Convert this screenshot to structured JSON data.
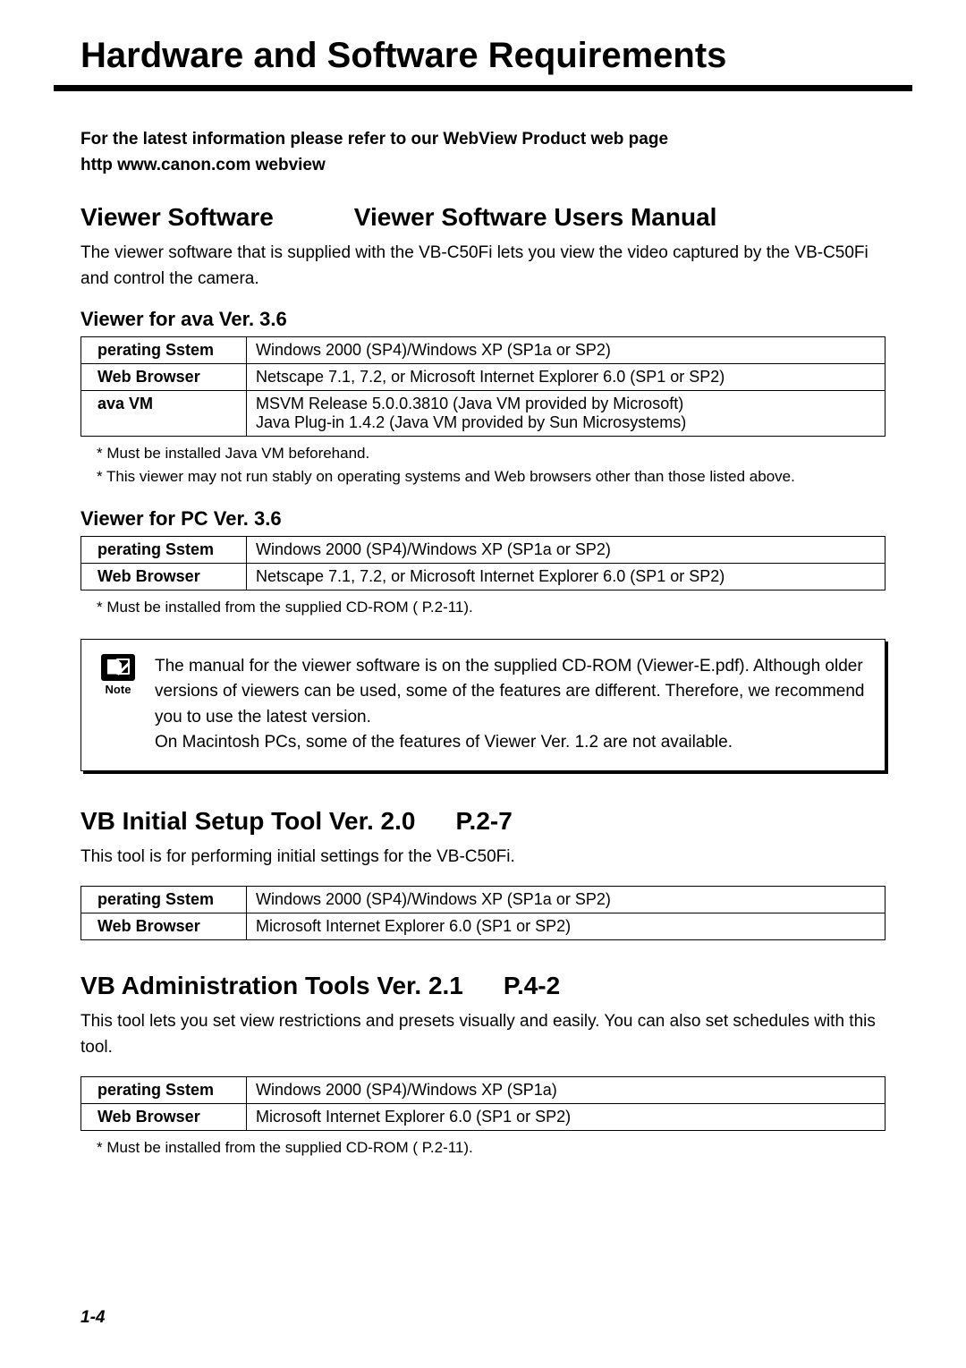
{
  "title": "Hardware and Software Requirements",
  "intro_line1": "For the latest information  please refer to our WebView Product web page",
  "intro_line2": "http   www.canon.com webview",
  "viewer": {
    "heading_left": "Viewer Software",
    "heading_right": "Viewer Software Users Manual",
    "desc": "The viewer software that is supplied with the VB-C50Fi lets you view the video captured by the VB-C50Fi and control the camera.",
    "java": {
      "title": "Viewer for  ava Ver. 3.6",
      "rows": [
        {
          "label": "perating Sstem",
          "value": "Windows 2000 (SP4)/Windows XP (SP1a or SP2)"
        },
        {
          "label": "Web Browser",
          "value": "Netscape 7.1, 7.2, or Microsoft Internet Explorer 6.0 (SP1 or SP2)"
        },
        {
          "label": "ava VM",
          "value": "MSVM Release 5.0.0.3810 (Java VM provided by Microsoft)\nJava Plug-in 1.4.2 (Java VM provided by Sun Microsystems)"
        }
      ],
      "footnote1": "* Must be installed Java VM beforehand.",
      "footnote2": "* This viewer may not run stably on operating systems and Web browsers other than those listed above."
    },
    "pc": {
      "title": "Viewer for PC Ver. 3.6",
      "rows": [
        {
          "label": "perating Sstem",
          "value": "Windows 2000 (SP4)/Windows XP (SP1a or SP2)"
        },
        {
          "label": "Web Browser",
          "value": "Netscape 7.1, 7.2, or Microsoft Internet Explorer 6.0 (SP1 or SP2)"
        }
      ],
      "footnote": "* Must be installed from the supplied CD-ROM (    P.2-11)."
    }
  },
  "note": {
    "label": "Note",
    "text": "The manual for the viewer software is on the supplied CD-ROM (Viewer-E.pdf). Although older versions of viewers can be used, some of the features are different. Therefore, we recommend you to use the latest version.\nOn Macintosh PCs, some of the features of Viewer Ver. 1.2 are not available."
  },
  "setup_tool": {
    "heading": "VB Initial Setup Tool Ver. 2.0",
    "ref": "P.2-7",
    "desc": "This tool is for performing initial settings for the VB-C50Fi.",
    "rows": [
      {
        "label": "perating Sstem",
        "value": "Windows 2000 (SP4)/Windows XP (SP1a or SP2)"
      },
      {
        "label": "Web Browser",
        "value": "Microsoft Internet Explorer 6.0 (SP1 or SP2)"
      }
    ]
  },
  "admin_tools": {
    "heading": "VB Administration Tools Ver. 2.1",
    "ref": "P.4-2",
    "desc": "This tool lets you set view restrictions and presets visually and easily. You can also set schedules with this tool.",
    "rows": [
      {
        "label": "perating Sstem",
        "value": "Windows 2000 (SP4)/Windows XP (SP1a)"
      },
      {
        "label": "Web Browser",
        "value": "Microsoft Internet Explorer 6.0 (SP1 or SP2)"
      }
    ],
    "footnote": "* Must be installed from the supplied CD-ROM (    P.2-11)."
  },
  "page_number": "1-4"
}
